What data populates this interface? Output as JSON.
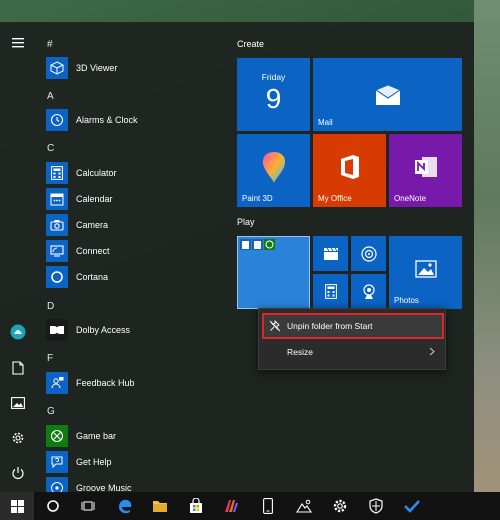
{
  "start_menu": {
    "rail": {
      "icons": [
        "hamburger-icon",
        "user-icon",
        "document-icon",
        "pictures-icon",
        "settings-icon",
        "power-icon"
      ]
    },
    "app_list": {
      "sections": [
        {
          "letter": "#",
          "apps": [
            {
              "label": "3D Viewer",
              "icon": "3d-viewer-icon"
            }
          ]
        },
        {
          "letter": "A",
          "apps": [
            {
              "label": "Alarms & Clock",
              "icon": "alarm-clock-icon"
            }
          ]
        },
        {
          "letter": "C",
          "apps": [
            {
              "label": "Calculator",
              "icon": "calculator-icon"
            },
            {
              "label": "Calendar",
              "icon": "calendar-icon"
            },
            {
              "label": "Camera",
              "icon": "camera-icon"
            },
            {
              "label": "Connect",
              "icon": "connect-icon"
            },
            {
              "label": "Cortana",
              "icon": "cortana-icon"
            }
          ]
        },
        {
          "letter": "D",
          "apps": [
            {
              "label": "Dolby Access",
              "icon": "dolby-icon"
            }
          ]
        },
        {
          "letter": "F",
          "apps": [
            {
              "label": "Feedback Hub",
              "icon": "feedback-icon"
            }
          ]
        },
        {
          "letter": "G",
          "apps": [
            {
              "label": "Game bar",
              "icon": "xbox-icon"
            },
            {
              "label": "Get Help",
              "icon": "help-icon"
            },
            {
              "label": "Groove Music",
              "icon": "music-icon"
            }
          ]
        }
      ]
    },
    "tiles": {
      "create_label": "Create",
      "play_label": "Play",
      "calendar_tile": {
        "day": "Friday",
        "date": "9"
      },
      "mail_label": "Mail",
      "paint3d_label": "Paint 3D",
      "myoffice_label": "My Office",
      "onenote_label": "OneNote",
      "photos_label": "Photos"
    },
    "context_menu": {
      "unpin_label": "Unpin folder from Start",
      "resize_label": "Resize"
    }
  },
  "colors": {
    "tile_blue": "#0b63c4",
    "office_orange": "#d83b01",
    "onenote_purple": "#7719aa",
    "highlight_red": "#e0242b"
  },
  "taskbar": {
    "icons": [
      "windows-start-icon",
      "cortana-search-icon",
      "task-view-icon",
      "edge-icon",
      "file-explorer-icon",
      "store-icon",
      "office-app-icon",
      "phone-icon",
      "photos-app-icon",
      "settings-app-icon",
      "security-shield-icon",
      "todo-check-icon"
    ]
  }
}
